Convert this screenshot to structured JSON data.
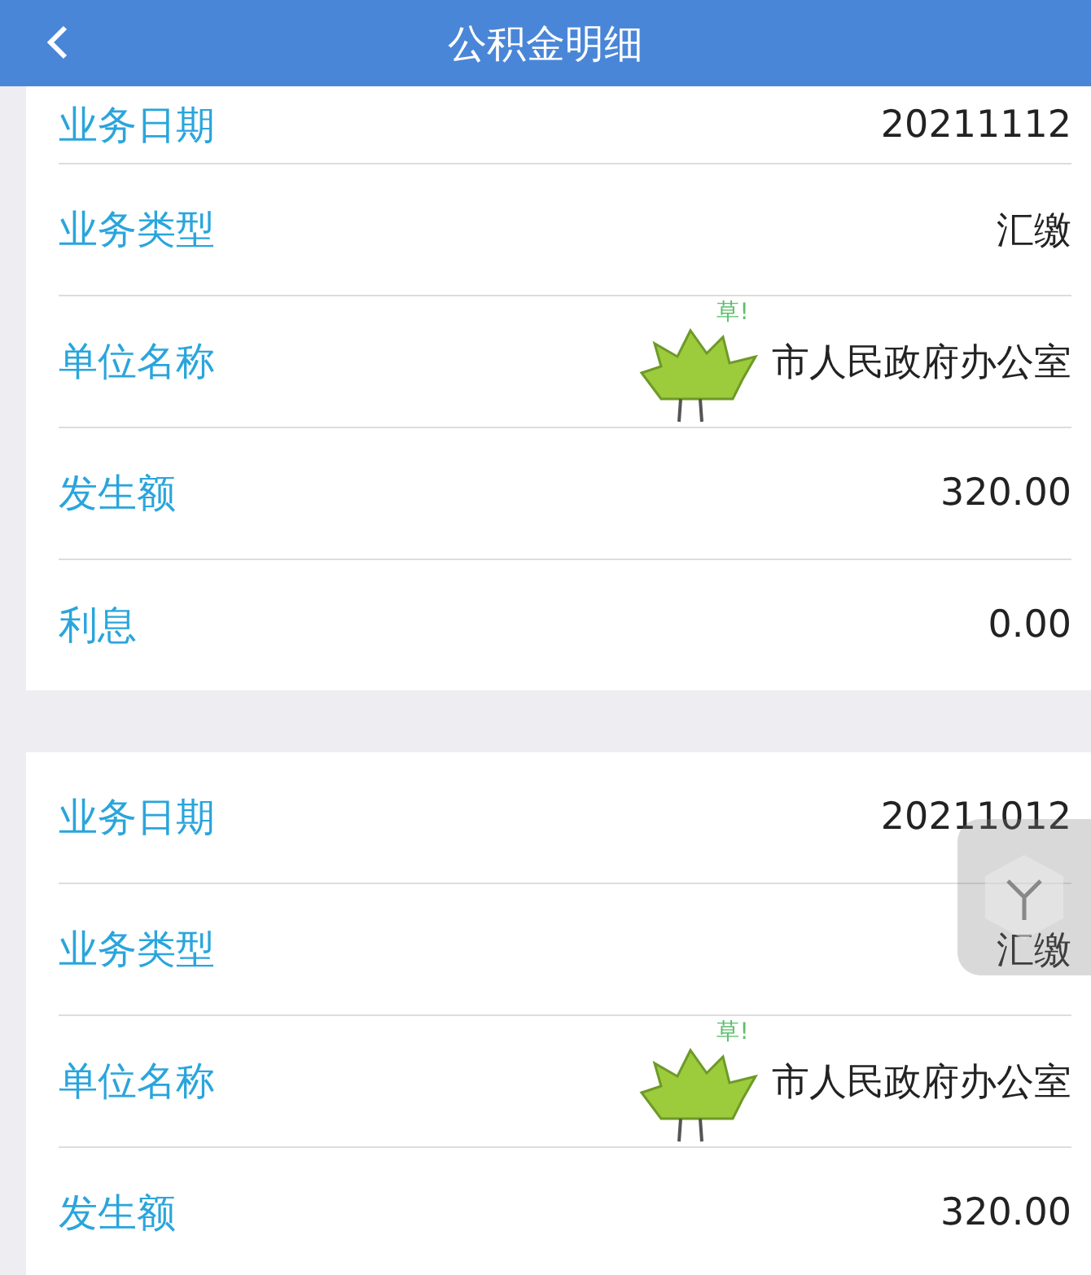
{
  "header": {
    "title": "公积金明细"
  },
  "cards": [
    {
      "rows": [
        {
          "label": "业务日期",
          "value": "20211112"
        },
        {
          "label": "业务类型",
          "value": "汇缴"
        },
        {
          "label": "单位名称",
          "value": "市人民政府办公室",
          "sticker": "草!"
        },
        {
          "label": "发生额",
          "value": "320.00"
        },
        {
          "label": "利息",
          "value": "0.00"
        }
      ]
    },
    {
      "rows": [
        {
          "label": "业务日期",
          "value": "20211012"
        },
        {
          "label": "业务类型",
          "value": "汇缴"
        },
        {
          "label": "单位名称",
          "value": "市人民政府办公室",
          "sticker": "草!"
        },
        {
          "label": "发生额",
          "value": "320.00"
        }
      ]
    }
  ]
}
